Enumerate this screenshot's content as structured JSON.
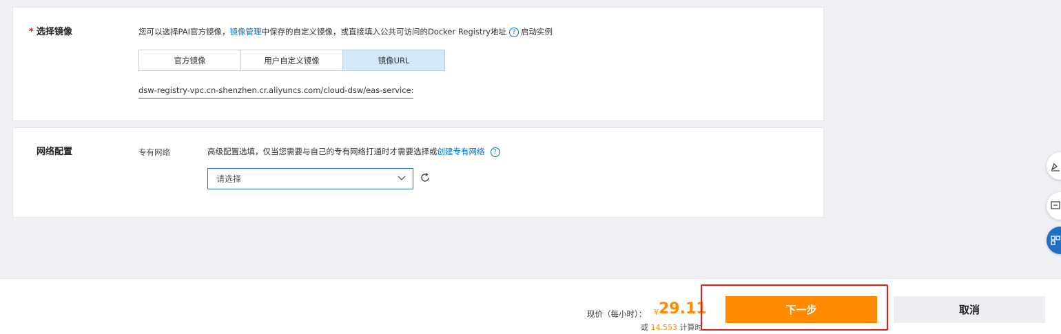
{
  "image_section": {
    "required_mark": "*",
    "label": "选择镜像",
    "desc_prefix": "您可以选择PAI官方镜像，",
    "desc_link": "镜像管理",
    "desc_middle": "中保存的自定义镜像，或直接填入公共可访问的Docker Registry地址",
    "help_glyph": "?",
    "desc_suffix": "启动实例",
    "tabs": [
      {
        "label": "官方镜像",
        "active": false
      },
      {
        "label": "用户自定义镜像",
        "active": false
      },
      {
        "label": "镜像URL",
        "active": true
      }
    ],
    "url_value": "dsw-registry-vpc.cn-shenzhen.cr.aliyuncs.com/cloud-dsw/eas-service:aigc-to"
  },
  "network_section": {
    "label": "网络配置",
    "vpc_label": "专有网络",
    "desc": "高级配置选填，仅当您需要与自己的专有网络打通时才需要选择或",
    "create_link": "创建专有网络",
    "help_glyph": "?",
    "select_placeholder": "请选择"
  },
  "footer": {
    "price_label": "现价（每小时）：",
    "currency": "¥",
    "price": "29.11",
    "alt_prefix": "或",
    "alt_value": "14.553",
    "alt_suffix": "计算时",
    "next_label": "下一步",
    "cancel_label": "取消"
  },
  "colors": {
    "accent_orange": "#ff8a00",
    "link_blue": "#0070cc",
    "highlight_red": "#e11d1d"
  },
  "icons": [
    "help-icon",
    "chevron-down-icon",
    "refresh-icon",
    "edit-icon",
    "chat-icon",
    "apps-icon"
  ]
}
